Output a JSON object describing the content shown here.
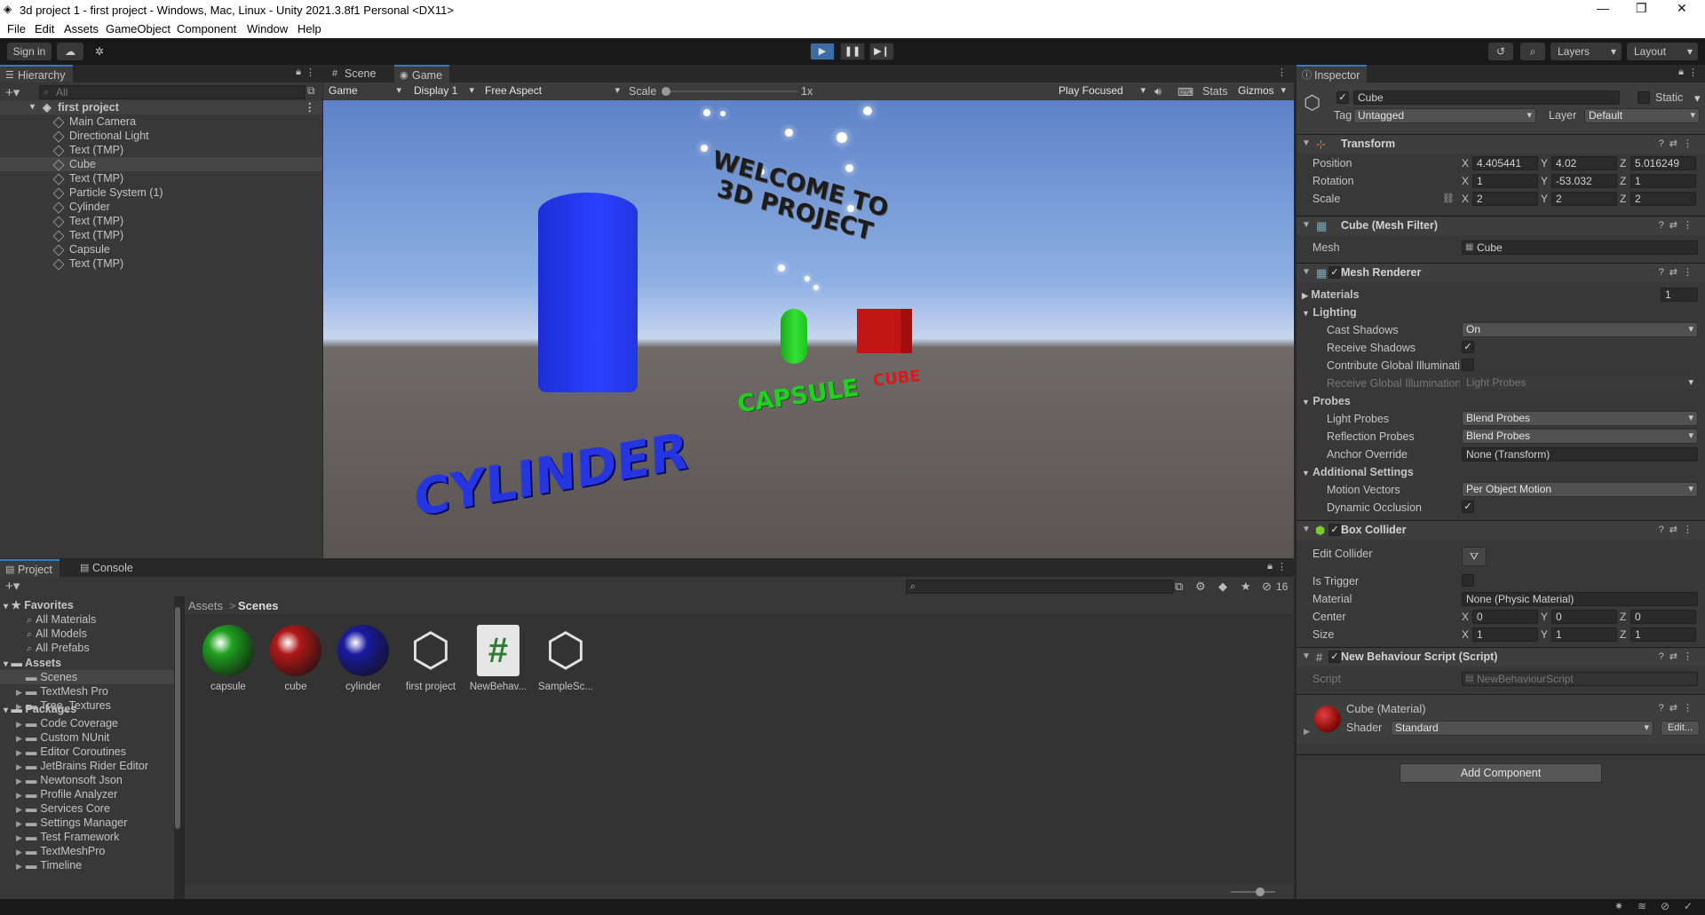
{
  "window": {
    "title": "3d project 1 - first project - Windows, Mac, Linux - Unity 2021.3.8f1 Personal <DX11>",
    "controls": [
      "—",
      "❐",
      "✕"
    ]
  },
  "menu": [
    "File",
    "Edit",
    "Assets",
    "GameObject",
    "Component",
    "Window",
    "Help"
  ],
  "toolbar": {
    "sign_in": "Sign in",
    "layers": "Layers",
    "layout": "Layout"
  },
  "hierarchy": {
    "tab": "Hierarchy",
    "search_placeholder": "All",
    "scene": "first project",
    "items": [
      "Main Camera",
      "Directional Light",
      "Text (TMP)",
      "Cube",
      "Text (TMP)",
      "Particle System (1)",
      "Cylinder",
      "Text (TMP)",
      "Text (TMP)",
      "Capsule",
      "Text (TMP)"
    ]
  },
  "game_view": {
    "tabs": [
      "Scene",
      "Game"
    ],
    "display_mode": "Game",
    "display": "Display 1",
    "aspect": "Free Aspect",
    "scale_label": "Scale",
    "scale_value": "1x",
    "play_focused": "Play Focused",
    "stats": "Stats",
    "gizmos": "Gizmos",
    "scene_texts": {
      "welcome_line1": "WELCOME TO",
      "welcome_line2": "3D PROJECT",
      "cylinder": "CYLINDER",
      "capsule": "CAPSULE",
      "cube": "CUBE"
    },
    "colors": {
      "cylinder": "#2233e6",
      "capsule": "#22cc22",
      "cube": "#cc1a1a"
    }
  },
  "project": {
    "tabs": [
      "Project",
      "Console"
    ],
    "badge": "16",
    "favorites_label": "Favorites",
    "favorites": [
      "All Materials",
      "All Models",
      "All Prefabs"
    ],
    "assets_label": "Assets",
    "assets": [
      "Scenes",
      "TextMesh Pro",
      "Tree_Textures"
    ],
    "packages_label": "Packages",
    "packages": [
      "Code Coverage",
      "Custom NUnit",
      "Editor Coroutines",
      "JetBrains Rider Editor",
      "Newtonsoft Json",
      "Profile Analyzer",
      "Services Core",
      "Settings Manager",
      "Test Framework",
      "TextMeshPro",
      "Timeline"
    ],
    "breadcrumb": [
      "Assets",
      "Scenes"
    ],
    "breadcrumb_sep": ">",
    "files": [
      {
        "name": "capsule",
        "icon": "green-sphere-icon"
      },
      {
        "name": "cube",
        "icon": "red-sphere-icon"
      },
      {
        "name": "cylinder",
        "icon": "blue-sphere-icon"
      },
      {
        "name": "first project",
        "icon": "unity-logo-icon"
      },
      {
        "name": "NewBehav...",
        "icon": "csharp-script-icon"
      },
      {
        "name": "SampleSc...",
        "icon": "unity-logo-icon"
      }
    ]
  },
  "inspector": {
    "tab": "Inspector",
    "object_name": "Cube",
    "static": "Static",
    "tag_label": "Tag",
    "tag": "Untagged",
    "layer_label": "Layer",
    "layer": "Default",
    "transform": {
      "title": "Transform",
      "position_label": "Position",
      "position": [
        "4.405441",
        "4.02",
        "5.016249"
      ],
      "rotation_label": "Rotation",
      "rotation": [
        "1",
        "-53.032",
        "1"
      ],
      "scale_label": "Scale",
      "scale": [
        "2",
        "2",
        "2"
      ]
    },
    "axes": [
      "X",
      "Y",
      "Z"
    ],
    "mesh_filter": {
      "title": "Cube (Mesh Filter)",
      "mesh_label": "Mesh",
      "mesh": "Cube"
    },
    "mesh_renderer": {
      "title": "Mesh Renderer",
      "materials_label": "Materials",
      "materials_count": "1",
      "lighting_label": "Lighting",
      "cast_shadows_label": "Cast Shadows",
      "cast_shadows": "On",
      "receive_shadows_label": "Receive Shadows",
      "contribute_gi_label": "Contribute Global Illuminati",
      "receive_gi_label": "Receive Global Illumination",
      "receive_gi": "Light Probes",
      "probes_label": "Probes",
      "light_probes_label": "Light Probes",
      "light_probes": "Blend Probes",
      "reflection_probes_label": "Reflection Probes",
      "reflection_probes": "Blend Probes",
      "anchor_override_label": "Anchor Override",
      "anchor_override": "None (Transform)",
      "additional_label": "Additional Settings",
      "motion_vectors_label": "Motion Vectors",
      "motion_vectors": "Per Object Motion",
      "dynamic_occlusion_label": "Dynamic Occlusion"
    },
    "box_collider": {
      "title": "Box Collider",
      "edit_collider_label": "Edit Collider",
      "is_trigger_label": "Is Trigger",
      "material_label": "Material",
      "material": "None (Physic Material)",
      "center_label": "Center",
      "center": [
        "0",
        "0",
        "0"
      ],
      "size_label": "Size",
      "size": [
        "1",
        "1",
        "1"
      ]
    },
    "script": {
      "title": "New Behaviour Script (Script)",
      "script_label": "Script",
      "script": "NewBehaviourScript"
    },
    "material": {
      "title": "Cube (Material)",
      "shader_label": "Shader",
      "shader": "Standard",
      "edit": "Edit..."
    },
    "add_component": "Add Component"
  }
}
